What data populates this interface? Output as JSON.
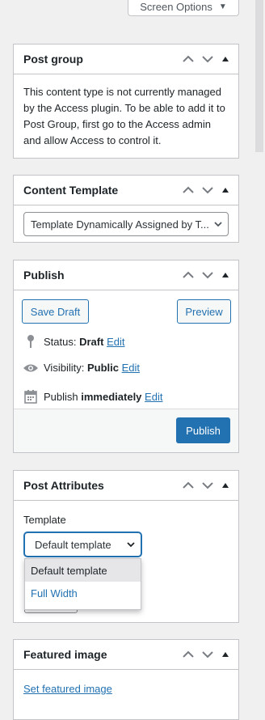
{
  "screen_options": {
    "label": "Screen Options"
  },
  "boxes": {
    "post_group": {
      "title": "Post group",
      "text": "This content type is not currently managed by the Access plugin. To be able to add it to Post Group, first go to the Access admin and allow Access to control it."
    },
    "content_template": {
      "title": "Content Template",
      "select_value": "Template Dynamically Assigned by T..."
    },
    "publish": {
      "title": "Publish",
      "save_draft": "Save Draft",
      "preview": "Preview",
      "status_label": "Status:",
      "status_value": "Draft",
      "visibility_label": "Visibility:",
      "visibility_value": "Public",
      "publish_label": "Publish",
      "publish_value": "immediately",
      "edit": "Edit",
      "publish_button": "Publish"
    },
    "post_attributes": {
      "title": "Post Attributes",
      "template_label": "Template",
      "selected": "Default template",
      "options": [
        "Default template",
        "Full Width"
      ]
    },
    "featured_image": {
      "title": "Featured image",
      "link": "Set featured image"
    }
  },
  "colors": {
    "accent": "#2271b1",
    "border": "#c3c4c7",
    "background": "#f0f0f1"
  }
}
